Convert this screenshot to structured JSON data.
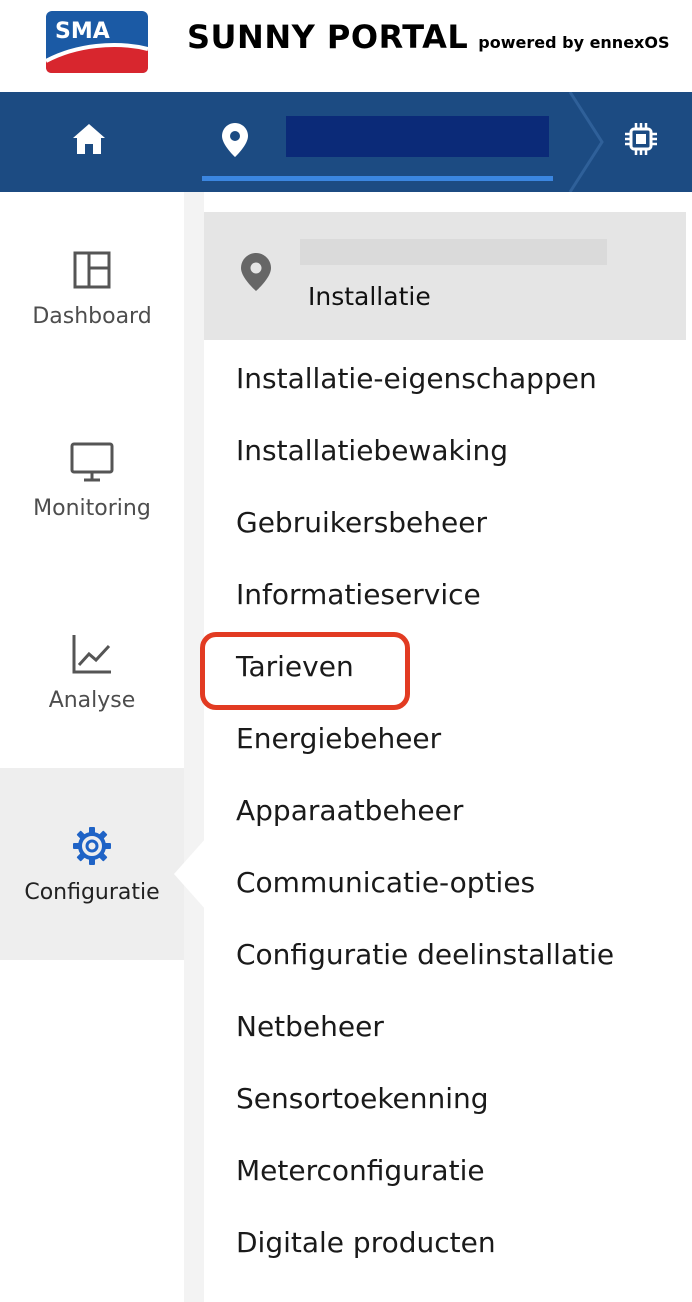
{
  "header": {
    "logo_text": "SMA",
    "brand_title": "SUNNY PORTAL",
    "brand_powered": "powered by ennexOS",
    "colors": {
      "logo_blue": "#1b5aa5",
      "logo_red": "#d8262e"
    }
  },
  "topnav": {
    "background": "#1c4b82",
    "home_icon": "home-icon",
    "location_icon": "location-pin-icon",
    "device_icon": "device-chip-icon"
  },
  "sidebar": {
    "items": [
      {
        "label": "Dashboard",
        "icon": "dashboard-layout-icon",
        "active": false
      },
      {
        "label": "Monitoring",
        "icon": "monitor-icon",
        "active": false
      },
      {
        "label": "Analyse",
        "icon": "line-chart-icon",
        "active": false
      },
      {
        "label": "Configuratie",
        "icon": "gear-icon",
        "active": true
      }
    ]
  },
  "panel": {
    "title": "Installatie",
    "menu": [
      "Installatie-eigenschappen",
      "Installatiebewaking",
      "Gebruikersbeheer",
      "Informatieservice",
      "Tarieven",
      "Energiebeheer",
      "Apparaatbeheer",
      "Communicatie-opties",
      "Configuratie deelinstallatie",
      "Netbeheer",
      "Sensortoekenning",
      "Meterconfiguratie",
      "Digitale producten"
    ],
    "highlighted_item": "Tarieven",
    "highlight_color": "#e23b22"
  }
}
